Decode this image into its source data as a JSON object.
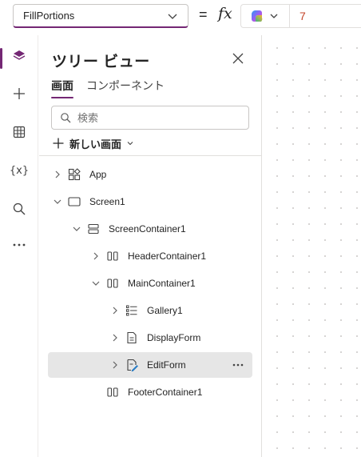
{
  "formula_bar": {
    "property_value": "FillPortions",
    "equals": "=",
    "fx_label": "fx",
    "formula": "7"
  },
  "rail": {
    "items": [
      {
        "icon": "layers-icon",
        "active": true
      },
      {
        "icon": "plus-icon"
      },
      {
        "icon": "table-icon"
      },
      {
        "icon": "variables-icon",
        "text": "{x}"
      },
      {
        "icon": "search-icon"
      },
      {
        "icon": "more-icon"
      }
    ]
  },
  "tree_panel": {
    "title": "ツリー ビュー",
    "tabs": [
      {
        "label": "画面",
        "active": true
      },
      {
        "label": "コンポーネント",
        "active": false
      }
    ],
    "search_placeholder": "検索",
    "new_screen_label": "新しい画面",
    "nodes": [
      {
        "label": "App",
        "level": 0,
        "expand": "collapsed",
        "icon": "app-icon"
      },
      {
        "label": "Screen1",
        "level": 0,
        "expand": "expanded",
        "icon": "screen-icon"
      },
      {
        "label": "ScreenContainer1",
        "level": 1,
        "expand": "expanded",
        "icon": "vertical-container-icon"
      },
      {
        "label": "HeaderContainer1",
        "level": 2,
        "expand": "collapsed",
        "icon": "horizontal-container-icon"
      },
      {
        "label": "MainContainer1",
        "level": 2,
        "expand": "expanded",
        "icon": "horizontal-container-icon"
      },
      {
        "label": "Gallery1",
        "level": 3,
        "expand": "collapsed",
        "icon": "gallery-icon"
      },
      {
        "label": "DisplayForm",
        "level": 3,
        "expand": "collapsed",
        "icon": "display-form-icon"
      },
      {
        "label": "EditForm",
        "level": 3,
        "expand": "collapsed",
        "icon": "edit-form-icon",
        "selected": true
      },
      {
        "label": "FooterContainer1",
        "level": 2,
        "expand": "none",
        "icon": "horizontal-container-icon"
      }
    ]
  },
  "colors": {
    "accent": "#742774",
    "formula_text": "#c4462b",
    "selected_row": "#e6e6e6"
  }
}
